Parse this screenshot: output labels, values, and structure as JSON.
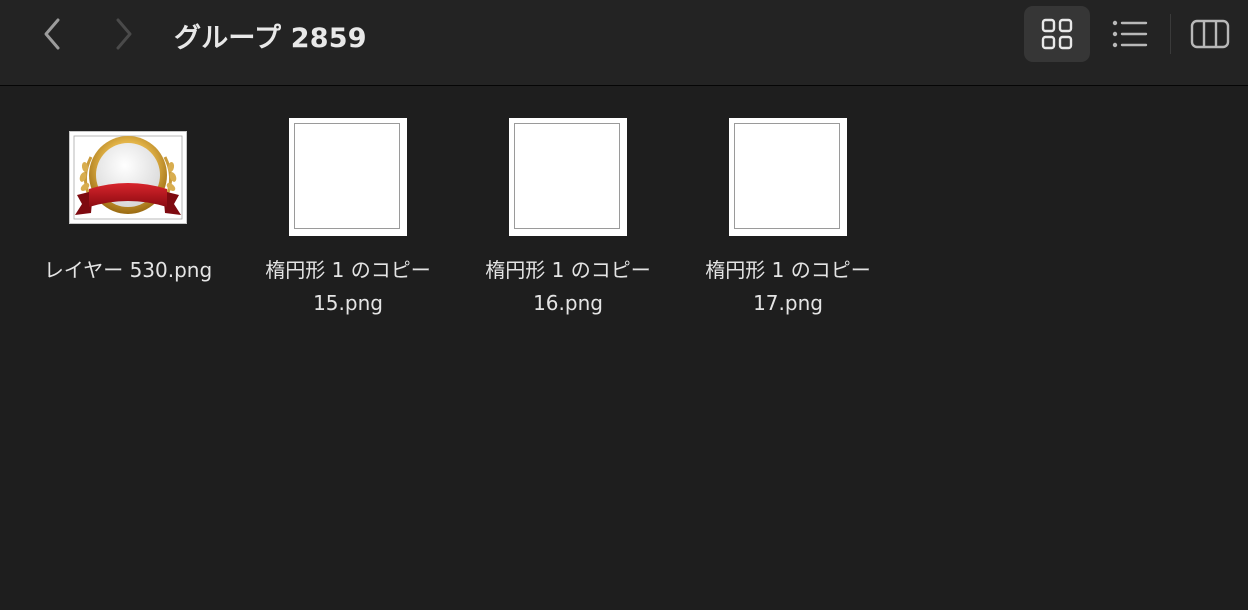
{
  "window": {
    "title": "グループ 2859"
  },
  "toolbar": {
    "back_icon": "chevron-left-icon",
    "forward_icon": "chevron-right-icon",
    "view_grid_icon": "grid-view-icon",
    "view_list_icon": "list-view-icon",
    "view_columns_icon": "column-view-icon",
    "active_view": "grid"
  },
  "files": [
    {
      "line1": "レイヤー 530.png",
      "line2": "",
      "thumbnail": "medal-icon"
    },
    {
      "line1": "楕円形 1 のコピー",
      "line2": "15.png",
      "thumbnail": "blank-image"
    },
    {
      "line1": "楕円形 1 のコピー",
      "line2": "16.png",
      "thumbnail": "blank-image"
    },
    {
      "line1": "楕円形 1 のコピー",
      "line2": "17.png",
      "thumbnail": "blank-image"
    }
  ],
  "colors": {
    "background": "#1e1e1e",
    "toolbar": "#232323",
    "active_view_button": "#363636",
    "text": "#e4e4e4",
    "medal_gold": "#d4a640",
    "ribbon_red": "#b3141b"
  }
}
